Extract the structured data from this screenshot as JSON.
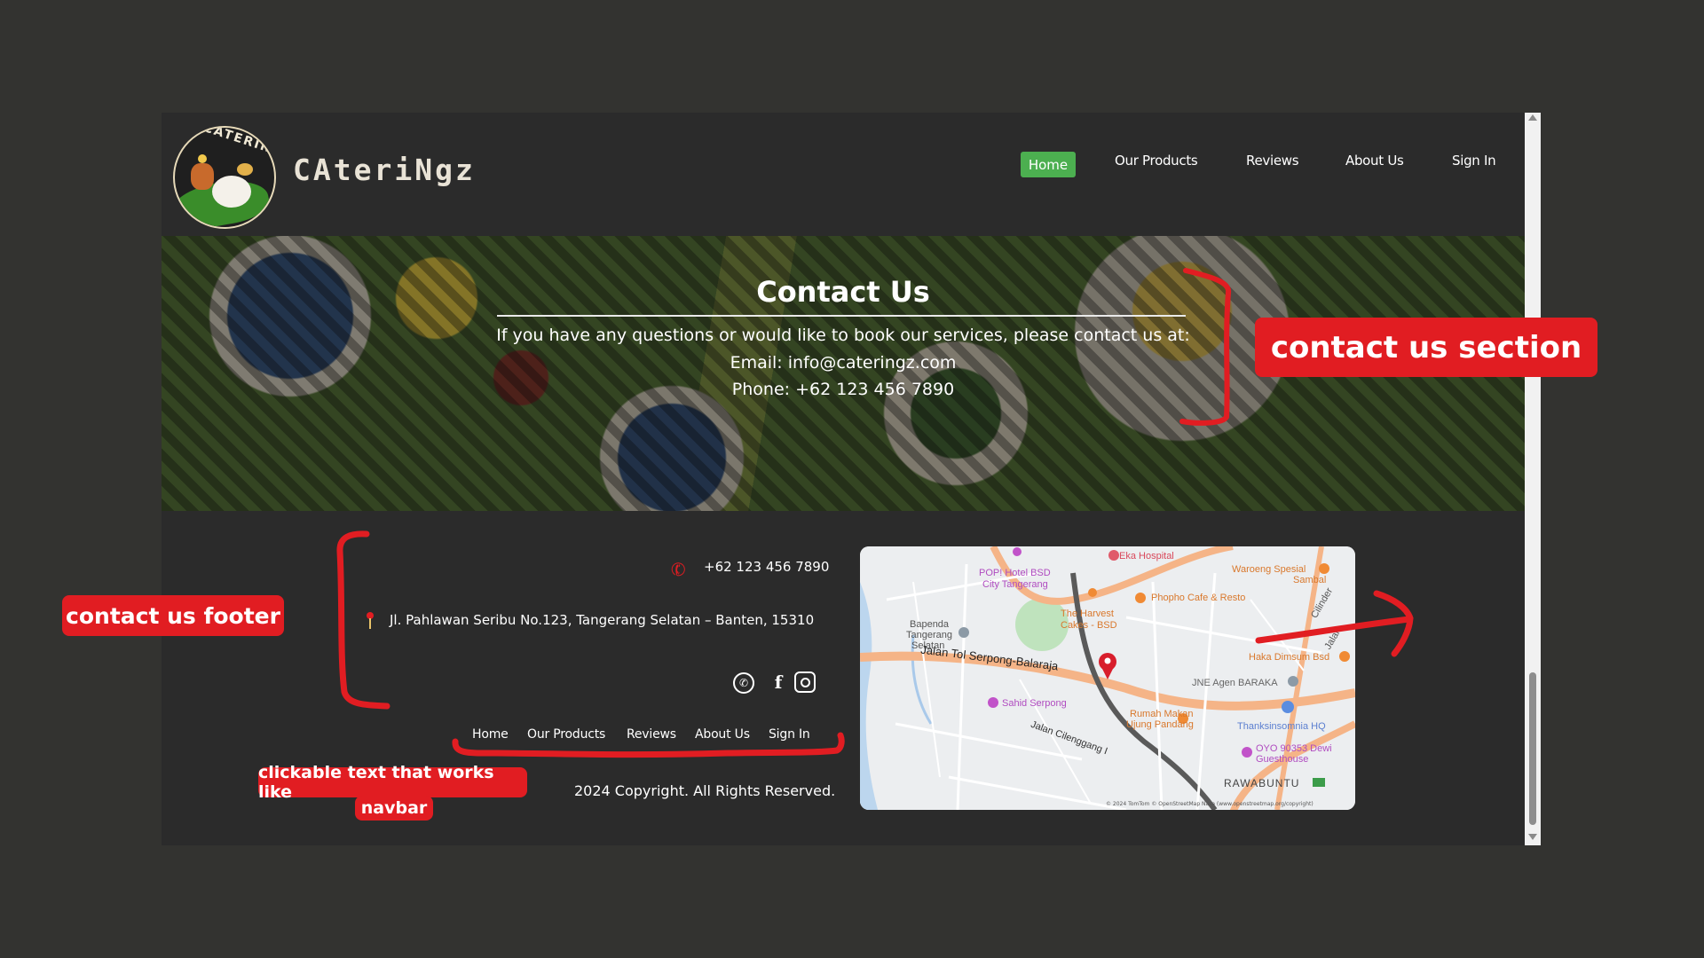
{
  "header": {
    "brand": "CAteriNgz",
    "logo_text": "CATERINGZ",
    "nav": [
      "Home",
      "Our Products",
      "Reviews",
      "About Us",
      "Sign In"
    ],
    "active_nav": "Home",
    "active_color": "#4caf50"
  },
  "hero": {
    "title": "Contact Us",
    "intro": "If you have any questions or would like to book our services, please contact us at:",
    "email": "Email: info@cateringz.com",
    "phone": "Phone: +62 123 456 7890"
  },
  "footer": {
    "phone": "+62 123 456 7890",
    "address": "Jl. Pahlawan Seribu No.123, Tangerang Selatan – Banten, 15310",
    "social_icons": [
      "whatsapp-icon",
      "facebook-icon",
      "instagram-icon"
    ],
    "nav": [
      "Home",
      "Our Products",
      "Reviews",
      "About Us",
      "Sign In"
    ],
    "copyright": "2024 Copyright. All Rights Reserved."
  },
  "map": {
    "labels": {
      "eka": "Eka Hospital",
      "popi": "POP! Hotel BSD",
      "popi2": "City Tangerang",
      "waroeng": "Waroeng Spesial",
      "waroeng2": "Sambal",
      "phopho": "Phopho Cafe & Resto",
      "harvest": "The Harvest",
      "harvest2": "Cakes - BSD",
      "bapenda": "Bapenda",
      "bapenda2": "Tangerang",
      "bapenda3": "Selatan",
      "jalantol": "Jalan Tol Serpong-Balaraja",
      "haka": "Haka Dimsum Bsd",
      "jne": "JNE Agen BARAKA",
      "sahid": "Sahid Serpong",
      "rumah": "Rumah Makan",
      "rumah2": "Ujung Pandang",
      "thanks": "Thanksinsomnia HQ",
      "cileng": "Jalan Cilenggang I",
      "oyo": "OYO 90353 Dewi",
      "oyo2": "Guesthouse",
      "rawa": "RAWABUNTU",
      "cilinder": "Cilinder",
      "jalan": "Jalan",
      "attribution": "© 2024 TomTom © OpenStreetMap Nasa (www.openstreetmap.org/copyright)"
    }
  },
  "annotations": {
    "section": "contact us section",
    "footer": "contact us footer",
    "navbar_line1": "clickable text that works like",
    "navbar_line2": "navbar",
    "color": "#e11d22"
  }
}
